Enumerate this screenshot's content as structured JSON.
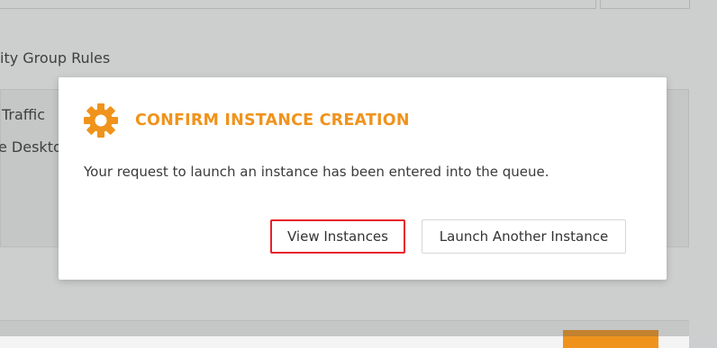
{
  "background": {
    "section_title": "ity Group Rules",
    "rules": [
      "Traffic",
      "e Desktop"
    ]
  },
  "modal": {
    "icon": "gear-icon",
    "title": "CONFIRM INSTANCE CREATION",
    "message": "Your request to launch an instance has been entered into the queue.",
    "buttons": {
      "view_instances": "View Instances",
      "launch_another": "Launch Another Instance"
    },
    "accent_color": "#f0931c",
    "highlight_color": "#e8202a"
  }
}
